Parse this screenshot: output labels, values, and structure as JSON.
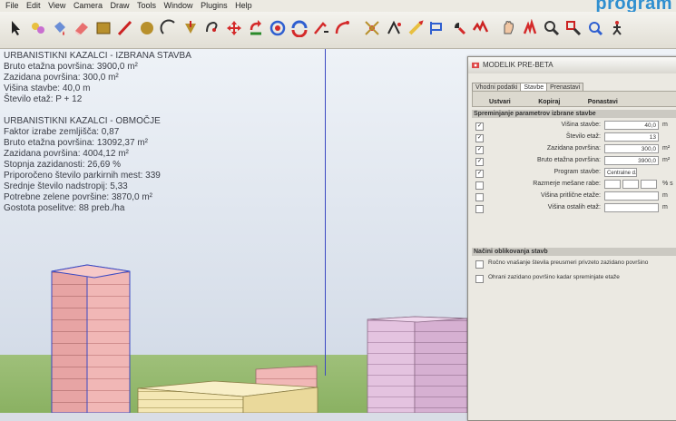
{
  "menu": {
    "items": [
      "File",
      "Edit",
      "View",
      "Camera",
      "Draw",
      "Tools",
      "Window",
      "Plugins",
      "Help"
    ]
  },
  "corner_text": "program",
  "toolbar": {
    "icons": [
      "select-icon",
      "component-icon",
      "paint-bucket-icon",
      "eraser-icon",
      "rectangle-icon",
      "line-icon",
      "circle-icon",
      "arc-icon",
      "push-pull-icon",
      "follow-me-icon",
      "move-icon",
      "rotate-icon",
      "offset-icon",
      "scale-icon",
      "tape-measure-icon",
      "protractor-icon",
      "dimension-icon",
      "text-icon",
      "axes-icon",
      "3d-text-icon",
      "section-icon",
      "orbit-icon",
      "pan-icon",
      "zoom-icon",
      "zoom-window-icon",
      "zoom-extents-icon",
      "previous-view-icon",
      "walk-icon"
    ]
  },
  "viewport": {
    "kazalci_stavba": {
      "title": "URBANISTIKNI KAZALCI - IZBRANA STAVBA",
      "lines": [
        "Bruto etažna površina: 3900,0 m²",
        "Zazidana površina: 300,0 m²",
        "Višina stavbe: 40,0 m",
        "Število etaž: P + 12"
      ]
    },
    "kazalci_obmocje": {
      "title": "URBANISTIKNI KAZALCI - OBMOČJE",
      "lines": [
        "Faktor izrabe zemljišča: 0,87",
        "Bruto etažna površina: 13092,37 m²",
        "Zazidana površina: 4004,12 m²",
        "Stopnja zazidanosti: 26,69 %",
        "Priporočeno število parkirnih mest: 339",
        "Srednje število nadstropij: 5,33",
        "Potrebne zelene površine: 3870,0 m²",
        "Gostota poselitve: 88 preb./ha"
      ]
    }
  },
  "dialog": {
    "title": "MODELIK PRE-BETA",
    "tabs": [
      "Vhodni podatki",
      "Stavbe",
      "Prenastavi"
    ],
    "active_tab": "Stavbe",
    "buttons": [
      "Ustvari",
      "Kopiraj",
      "Ponastavi"
    ],
    "section1_title": "Spreminjanje parametrov izbrane stavbe",
    "params": [
      {
        "label": "Višina stavbe:",
        "value": "40,0",
        "unit": "m",
        "checked": true
      },
      {
        "label": "Število etaž:",
        "value": "13",
        "unit": "",
        "checked": true
      },
      {
        "label": "Zazidana površina:",
        "value": "300,0",
        "unit": "m²",
        "checked": true
      },
      {
        "label": "Bruto etažna površina:",
        "value": "3900,0",
        "unit": "m²",
        "checked": true
      },
      {
        "label": "Program stavbe:",
        "value": "Centralne d...",
        "unit": "",
        "checked": true
      },
      {
        "label": "Razmerje mešane rabe:",
        "value": "",
        "unit": "% s",
        "checked": false
      },
      {
        "label": "Višina pritlične etaže:",
        "value": "",
        "unit": "m",
        "checked": false
      },
      {
        "label": "Višina ostalih etaž:",
        "value": "",
        "unit": "m",
        "checked": false
      }
    ],
    "section2_title": "Načini oblikovanja stavb",
    "options": [
      "Ročno vnašanje števila preusmeri privzeto zazidano površino",
      "Ohrani zazidano površino kadar spreminjate etaže"
    ]
  },
  "colors": {
    "menu_bg": "#eceae2",
    "toolbar_bg": "#e8e6de",
    "sky": "#d4dce8",
    "ground": "#8ab162",
    "building_pink": "#f1b7b6",
    "building_lilac": "#e4c3e0",
    "building_cream": "#f4e7b4",
    "axis_blue": "#3b49c2",
    "text_grey": "#3a3d46",
    "corner_text": "#2f8fd0"
  }
}
